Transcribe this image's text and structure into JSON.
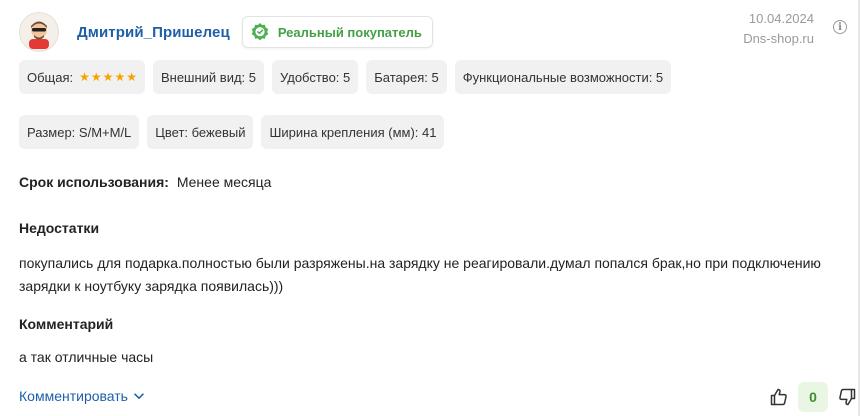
{
  "review": {
    "author": "Дмитрий_Пришелец",
    "badge": "Реальный покупатель",
    "date": "10.04.2024",
    "source": "Dns-shop.ru",
    "info_icon": "info-icon"
  },
  "ratings": {
    "overall_label": "Общая:",
    "overall_stars": 5,
    "items": [
      {
        "label": "Внешний вид: 5"
      },
      {
        "label": "Удобство: 5"
      },
      {
        "label": "Батарея: 5"
      },
      {
        "label": "Функциональные возможности: 5"
      }
    ]
  },
  "attributes": [
    {
      "label": "Размер: S/M+M/L"
    },
    {
      "label": "Цвет: бежевый"
    },
    {
      "label": "Ширина крепления (мм): 41"
    }
  ],
  "usage": {
    "label": "Срок использования:",
    "value": "Менее месяца"
  },
  "cons": {
    "title": "Недостатки",
    "text": "покупались для подарка.полностью были разряжены.на зарядку не реагировали.думал попался брак,но при подключению зарядки к ноутбуку зарядка появилась)))"
  },
  "comment": {
    "title": "Комментарий",
    "text": "а так отличные часы"
  },
  "actions": {
    "comment_link": "Комментировать",
    "votes": "0"
  },
  "colors": {
    "link": "#1f5fa9",
    "badge_green": "#43a047",
    "star": "#f7a200",
    "chip_bg": "#f1f1f1",
    "vote_bg": "#eaf6e4"
  }
}
